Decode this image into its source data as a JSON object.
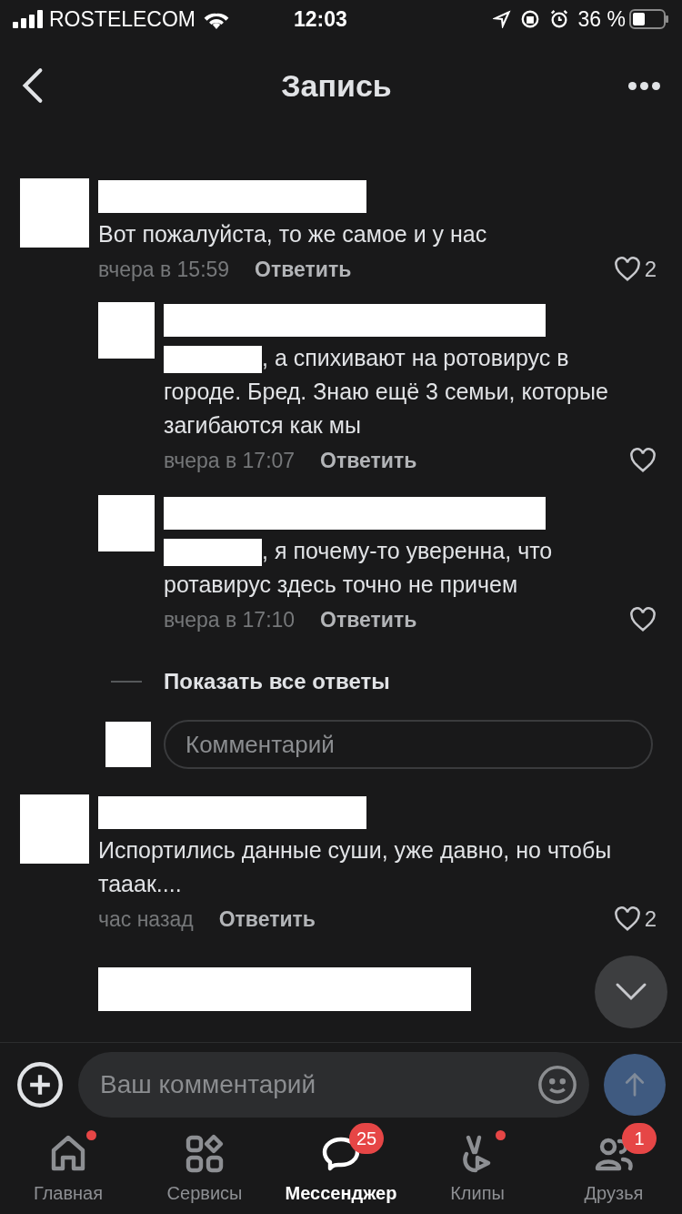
{
  "status_bar": {
    "carrier": "ROSTELECOM",
    "time": "12:03",
    "battery": "36 %"
  },
  "header": {
    "title": "Запись"
  },
  "comments": [
    {
      "kind": "comment",
      "text": "Вот пожалуйста, то же самое и у нас",
      "mention_redacted": false,
      "time": "вчера в 15:59",
      "reply": "Ответить",
      "likes": "2",
      "replies": [
        {
          "kind": "comment",
          "text": ", а спихивают на ротовирус в городе. Бред. Знаю ещё 3 семьи, которые загибаются как мы",
          "mention_redacted": true,
          "time": "вчера в 17:07",
          "reply": "Ответить"
        },
        {
          "kind": "comment",
          "text": ", я почему-то уверенна, что ротавирус здесь точно не причем",
          "mention_redacted": true,
          "time": "вчера в 17:10",
          "reply": "Ответить"
        }
      ],
      "show_all": "Показать все ответы",
      "comment_placeholder": "Комментарий"
    },
    {
      "kind": "comment",
      "text": "Испортились данные суши, уже давно, но чтобы тааак....",
      "mention_redacted": false,
      "time": "час назад",
      "reply": "Ответить",
      "likes": "2"
    },
    {
      "kind": "partial"
    }
  ],
  "composer": {
    "placeholder": "Ваш комментарий"
  },
  "tab_bar": [
    {
      "label": "Главная",
      "selected": false,
      "dot": true
    },
    {
      "label": "Сервисы",
      "selected": false,
      "dot": false
    },
    {
      "label": "Мессенджер",
      "selected": true,
      "dot": false,
      "badge": "25"
    },
    {
      "label": "Клипы",
      "selected": false,
      "dot": true
    },
    {
      "label": "Друзья",
      "selected": false,
      "dot": false,
      "badge": "1"
    }
  ]
}
